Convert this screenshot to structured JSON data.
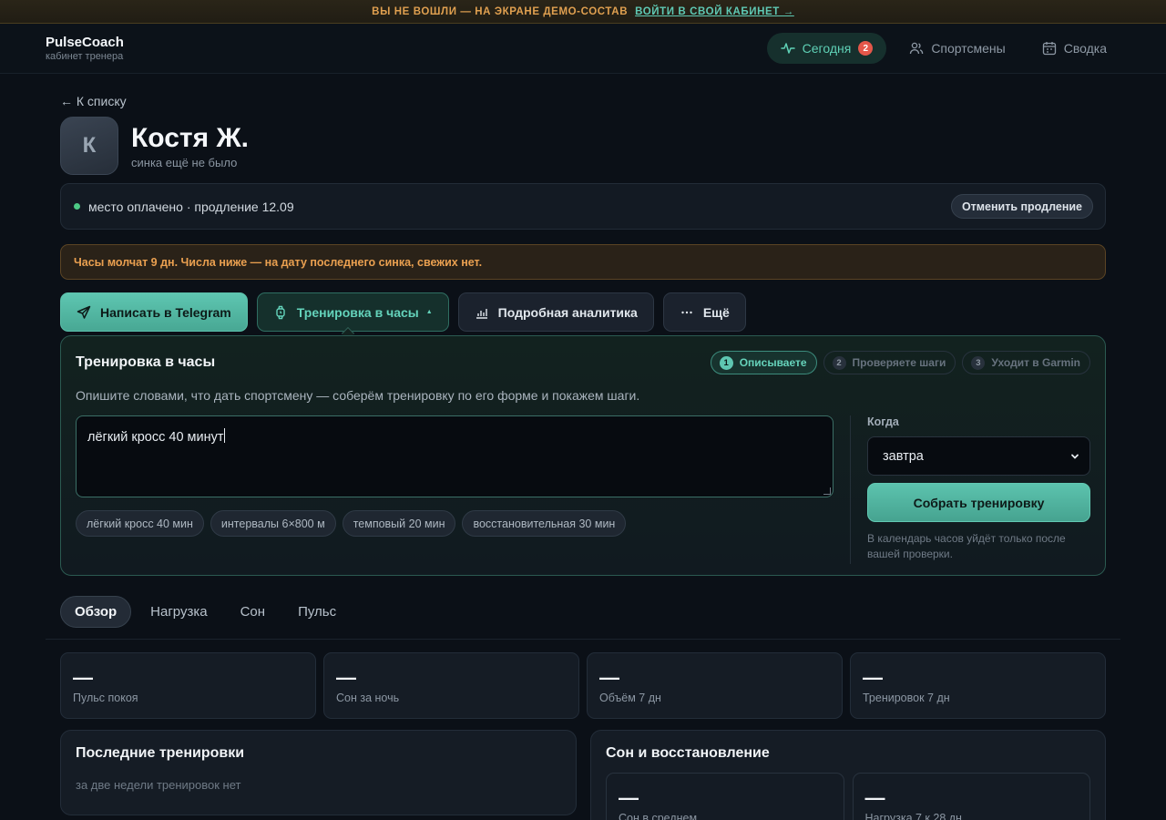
{
  "banner": {
    "warning": "ВЫ НЕ ВОШЛИ — НА ЭКРАНЕ ДЕМО-СОСТАВ",
    "login_link": "ВОЙТИ В СВОЙ КАБИНЕТ →"
  },
  "brand": {
    "name": "PulseCoach",
    "subtitle": "кабинет тренера"
  },
  "nav": {
    "items": [
      {
        "label": "Сегодня",
        "badge": "2",
        "icon": "pulse-icon"
      },
      {
        "label": "Спортсмены",
        "icon": "users-icon"
      },
      {
        "label": "Сводка",
        "icon": "calendar-icon"
      }
    ]
  },
  "back_link": "← К списку",
  "athlete": {
    "initial": "К",
    "name": "Костя Ж.",
    "sync_status": "синка ещё не было"
  },
  "subscription": {
    "status": "место оплачено · продление 12.09",
    "cancel_label": "Отменить продление",
    "status_color": "#4cc985"
  },
  "alert": "Часы молчат 9 дн. Числа ниже — на дату последнего синка, свежих нет.",
  "actions": {
    "telegram": "Написать в Telegram",
    "workout": "Тренировка в часы",
    "workout_caret": "▲",
    "analytics": "Подробная аналитика",
    "more": "Ещё"
  },
  "workout_panel": {
    "title": "Тренировка в часы",
    "steps": [
      {
        "num": "1",
        "label": "Описываете"
      },
      {
        "num": "2",
        "label": "Проверяете шаги"
      },
      {
        "num": "3",
        "label": "Уходит в Garmin"
      }
    ],
    "description": "Опишите словами, что дать спортсмену — соберём тренировку по его форме и покажем шаги.",
    "input_value": "лёгкий кросс 40 минут",
    "chips": [
      "лёгкий кросс 40 мин",
      "интервалы 6×800 м",
      "темповый 20 мин",
      "восстановительная 30 мин"
    ],
    "when_label": "Когда",
    "when_value": "завтра",
    "build_label": "Собрать тренировку",
    "hint": "В календарь часов уйдёт только после вашей проверки."
  },
  "tabs": [
    "Обзор",
    "Нагрузка",
    "Сон",
    "Пульс"
  ],
  "stats": [
    {
      "value": "—",
      "label": "Пульс покоя"
    },
    {
      "value": "—",
      "label": "Сон за ночь"
    },
    {
      "value": "—",
      "label": "Объём 7 дн"
    },
    {
      "value": "—",
      "label": "Тренировок 7 дн"
    }
  ],
  "recent": {
    "title": "Последние тренировки",
    "empty": "за две недели тренировок нет"
  },
  "sleep": {
    "title": "Сон и восстановление",
    "items": [
      {
        "value": "—",
        "label": "Сон в среднем"
      },
      {
        "value": "—",
        "label": "Нагрузка 7 к 28 дн"
      }
    ]
  },
  "colors": {
    "accent": "#5ec6b1",
    "warning": "#e0a050",
    "badge": "#e4574a",
    "background": "#0b1017"
  }
}
